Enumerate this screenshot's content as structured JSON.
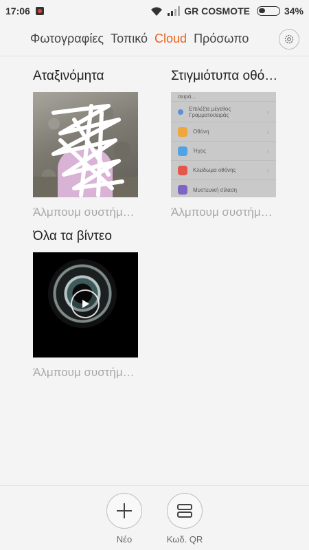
{
  "status_bar": {
    "time": "17:06",
    "carrier": "GR COSMOTE",
    "battery_percent_label": "34%",
    "battery_level": 0.34
  },
  "tabs": [
    {
      "label": "Φωτογραφίες",
      "active": false
    },
    {
      "label": "Τοπικό",
      "active": false
    },
    {
      "label": "Cloud",
      "active": true
    },
    {
      "label": "Πρόσωπο",
      "active": false
    }
  ],
  "accent_color": "#e8621e",
  "albums": [
    {
      "title": "Αταξινόμητα",
      "subtitle": "Άλμπουμ συστήματος",
      "kind": "photo"
    },
    {
      "title": "Στιγμιότυπα οθόνης",
      "subtitle": "Άλμπουμ συστήματος",
      "kind": "screenshot",
      "preview_rows": [
        {
          "label": "σειρά...",
          "icon_color": "#c9c9c9"
        },
        {
          "label": "Επιλέξτε μέγεθος Γραμματοσειράς",
          "icon_color": "#5b8fd6"
        },
        {
          "label": "Οθόνη",
          "icon_color": "#f0a63a"
        },
        {
          "label": "Ήχος",
          "icon_color": "#4fa3e6"
        },
        {
          "label": "Κλείδωμα οθόνης",
          "icon_color": "#e5574c"
        },
        {
          "label": "Μυστευική σίλαση",
          "icon_color": "#7e65c4"
        }
      ]
    },
    {
      "title": "Όλα τα βίντεο",
      "subtitle": "Άλμπουμ συστήματος",
      "kind": "video"
    }
  ],
  "bottom_actions": {
    "new_label": "Νέο",
    "qr_label": "Κωδ. QR"
  }
}
